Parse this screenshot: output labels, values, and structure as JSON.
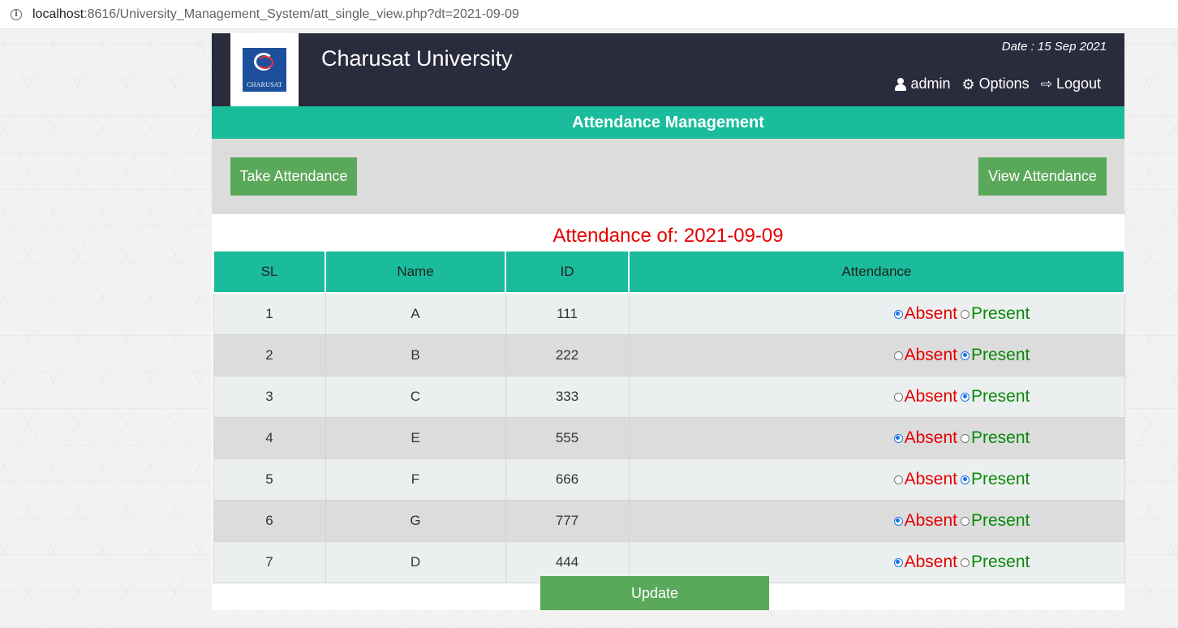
{
  "browser": {
    "url_host": "localhost",
    "url_path": ":8616/University_Management_System/att_single_view.php?dt=2021-09-09"
  },
  "header": {
    "logo_text": "CHARUSAT",
    "title": "Charusat University",
    "date": "Date : 15 Sep 2021",
    "nav": {
      "user": "admin",
      "options": "Options",
      "logout": "Logout"
    }
  },
  "section_title": "Attendance Management",
  "actions": {
    "take": "Take Attendance",
    "view": "View Attendance"
  },
  "attendance_title": "Attendance of: 2021-09-09",
  "table": {
    "headers": [
      "SL",
      "Name",
      "ID",
      "Attendance"
    ],
    "absent_label": "Absent",
    "present_label": "Present",
    "rows": [
      {
        "sl": "1",
        "name": "A",
        "id": "111",
        "status": "absent"
      },
      {
        "sl": "2",
        "name": "B",
        "id": "222",
        "status": "present"
      },
      {
        "sl": "3",
        "name": "C",
        "id": "333",
        "status": "present"
      },
      {
        "sl": "4",
        "name": "E",
        "id": "555",
        "status": "absent"
      },
      {
        "sl": "5",
        "name": "F",
        "id": "666",
        "status": "present"
      },
      {
        "sl": "6",
        "name": "G",
        "id": "777",
        "status": "absent"
      },
      {
        "sl": "7",
        "name": "D",
        "id": "444",
        "status": "absent"
      }
    ]
  },
  "update_label": "Update",
  "colors": {
    "header_bg": "#2a2b3d",
    "accent": "#1abc9c",
    "button": "#5aa859",
    "absent": "#e50000",
    "present": "#0a8a0a"
  }
}
